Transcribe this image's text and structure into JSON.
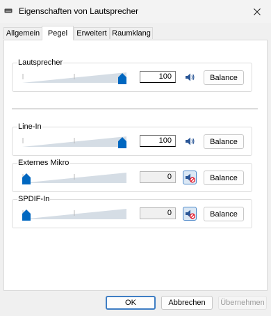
{
  "window": {
    "title": "Eigenschaften von Lautsprecher",
    "app_icon": "speaker-device-icon",
    "close_icon": "close-icon"
  },
  "tabs": [
    {
      "label": "Allgemein",
      "active": false
    },
    {
      "label": "Pegel",
      "active": true
    },
    {
      "label": "Erweitert",
      "active": false
    },
    {
      "label": "Raumklang",
      "active": false
    }
  ],
  "groups": [
    {
      "label": "Lautsprecher",
      "level": 100,
      "value": "100",
      "muted": false,
      "balance_label": "Balance"
    },
    {
      "label": "Line-In",
      "level": 100,
      "value": "100",
      "muted": false,
      "balance_label": "Balance"
    },
    {
      "label": "Externes Mikro",
      "level": 0,
      "value": "0",
      "muted": true,
      "balance_label": "Balance"
    },
    {
      "label": "SPDIF-In",
      "level": 0,
      "value": "0",
      "muted": true,
      "balance_label": "Balance"
    }
  ],
  "footer": {
    "ok_label": "OK",
    "cancel_label": "Abbrechen",
    "apply_label": "Übernehmen"
  },
  "colors": {
    "accent": "#0067c0",
    "track_fill": "#d5dde5",
    "muted_symbol": "#e81123"
  }
}
